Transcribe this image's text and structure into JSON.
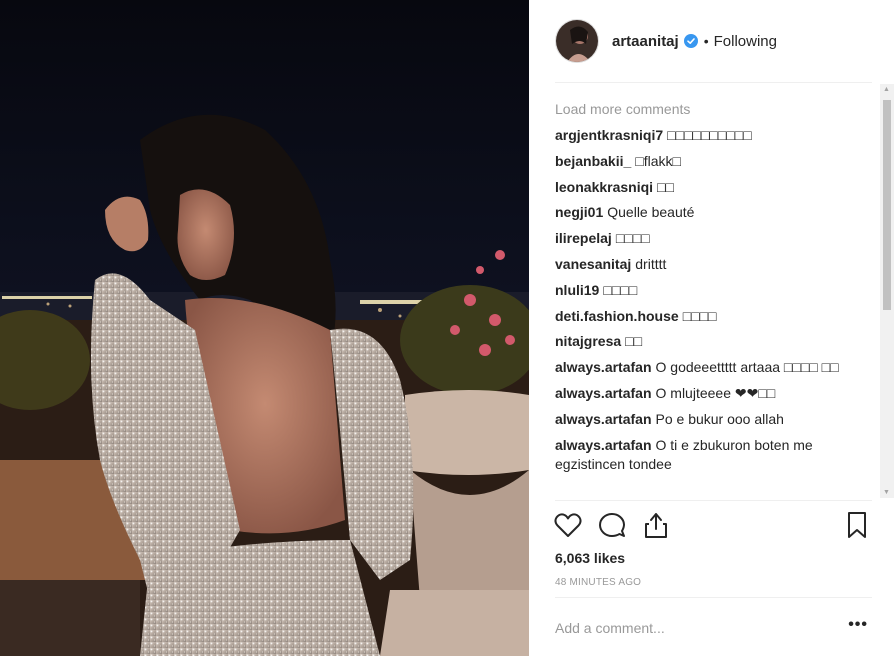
{
  "post": {
    "username": "artaanitaj",
    "follow_status": "Following",
    "dot": "•",
    "load_more": "Load more comments",
    "comments": [
      {
        "user": "argjentkrasniqi7",
        "text": "□□□□□□□□□□"
      },
      {
        "user": "bejanbakii_",
        "text": "□flakk□"
      },
      {
        "user": "leonakkrasniqi",
        "text": "□□"
      },
      {
        "user": "negji01",
        "text": "Quelle beauté"
      },
      {
        "user": "ilirepelaj",
        "text": "□□□□"
      },
      {
        "user": "vanesanitaj",
        "text": "dritttt"
      },
      {
        "user": "nluli19",
        "text": "□□□□"
      },
      {
        "user": "deti.fashion.house",
        "text": "□□□□"
      },
      {
        "user": "nitajgresa",
        "text": "□□"
      },
      {
        "user": "always.artafan",
        "text": "O godeeettttt artaaa □□□□ □□"
      },
      {
        "user": "always.artafan",
        "text": "O mlujteeee ❤❤□□"
      },
      {
        "user": "always.artafan",
        "text": "Po e bukur ooo allah"
      },
      {
        "user": "always.artafan",
        "text": "O ti e zbukuron boten me egzistincen tondee"
      }
    ],
    "likes": "6,063 likes",
    "time": "48 MINUTES AGO",
    "add_comment_placeholder": "Add a comment...",
    "more_options": "•••",
    "icons": {
      "like": "heart-icon",
      "comment": "comment-icon",
      "share": "share-icon",
      "save": "bookmark-icon",
      "verified": "verified-badge-icon"
    },
    "colors": {
      "verified": "#3897f0",
      "muted": "#999999",
      "text": "#262626"
    }
  }
}
